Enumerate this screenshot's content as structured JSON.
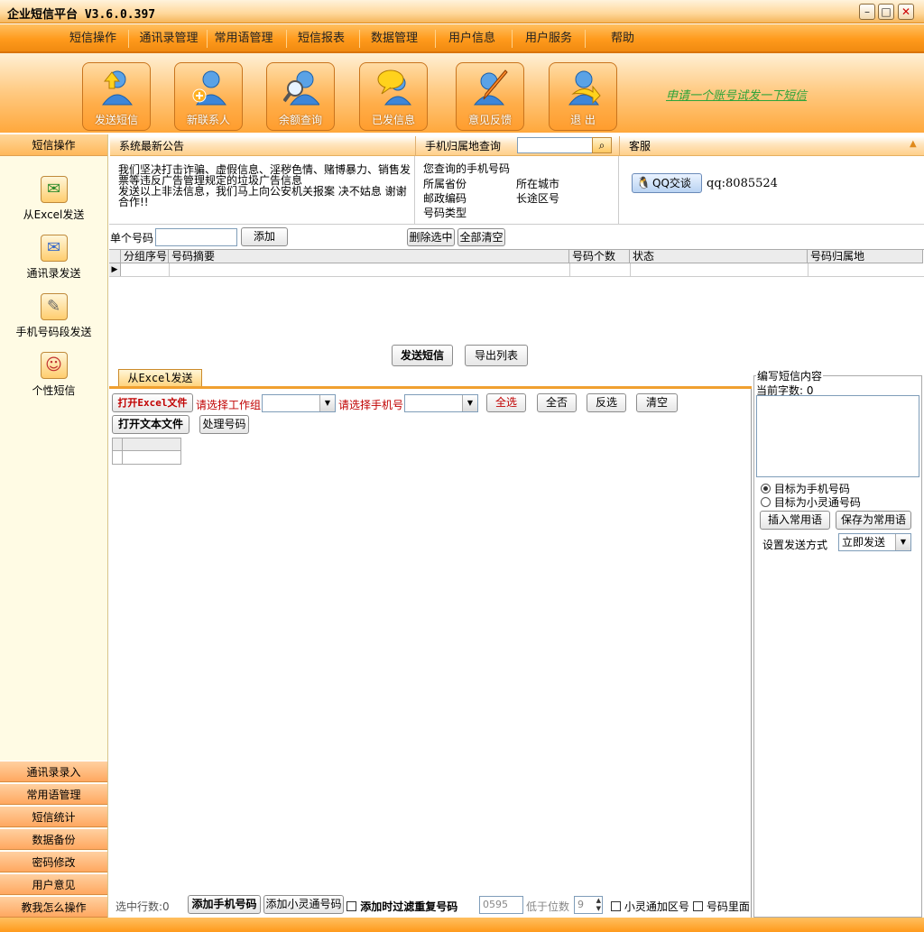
{
  "app": {
    "title": "企业短信平台 V3.6.0.397"
  },
  "window_controls": {
    "minimize": "–",
    "maximize": "□",
    "close": "✕"
  },
  "menu": [
    "短信操作",
    "通讯录管理",
    "常用语管理",
    "短信报表",
    "数据管理",
    "用户信息",
    "用户服务",
    "帮助"
  ],
  "toolbar": [
    {
      "label": "发送短信",
      "icon": "send-sms-icon"
    },
    {
      "label": "新联系人",
      "icon": "new-contact-icon"
    },
    {
      "label": "余额查询",
      "icon": "balance-query-icon"
    },
    {
      "label": "已发信息",
      "icon": "sent-messages-icon"
    },
    {
      "label": "意见反馈",
      "icon": "feedback-icon"
    },
    {
      "label": "退  出",
      "icon": "exit-icon"
    }
  ],
  "trial_link": "申请一个账号试发一下短信",
  "sidebar": {
    "header": "短信操作",
    "items": [
      {
        "label": "从Excel发送",
        "icon": "excel-send-icon"
      },
      {
        "label": "通讯录发送",
        "icon": "addressbook-send-icon"
      },
      {
        "label": "手机号码段发送",
        "icon": "number-range-send-icon"
      },
      {
        "label": "个性短信",
        "icon": "personal-sms-icon"
      }
    ],
    "bottom": [
      "通讯录录入",
      "常用语管理",
      "短信统计",
      "数据备份",
      "密码修改",
      "用户意见",
      "教我怎么操作"
    ]
  },
  "notice": {
    "header": "系统最新公告",
    "lines": [
      "我们坚决打击诈骗、虚假信息、淫秽色情、赌博暴力、销售发",
      "票等违反广告管理规定的垃圾广告信息",
      "发送以上非法信息，我们马上向公安机关报案 决不姑息 谢谢",
      "合作!!"
    ]
  },
  "lookup": {
    "header": "手机归属地查询",
    "query_label": "您查询的手机号码",
    "province": "所属省份",
    "city": "所在城市",
    "postcode": "邮政编码",
    "areacode": "长途区号",
    "type": "号码类型"
  },
  "service": {
    "header": "客服",
    "qq_button": "QQ交谈",
    "qq": "qq:8085524"
  },
  "single": {
    "label": "单个号码",
    "add": "添加",
    "delete_selected": "删除选中",
    "clear_all": "全部清空"
  },
  "grid": {
    "columns": [
      "分组序号",
      "号码摘要",
      "号码个数",
      "状态",
      "号码归属地"
    ]
  },
  "actions": {
    "send": "发送短信",
    "export": "导出列表"
  },
  "excel_tab": {
    "tab": "从Excel发送",
    "open_excel": "打开Excel文件",
    "select_sheet": "请选择工作组",
    "select_phone": "请选择手机号",
    "select_all": "全选",
    "select_none": "全否",
    "invert": "反选",
    "clear": "清空",
    "open_text": "打开文本文件",
    "process": "处理号码"
  },
  "compose": {
    "title": "编写短信内容",
    "count_label": "当前字数:",
    "count": "0",
    "target_mobile": "目标为手机号码",
    "target_phs": "目标为小灵通号码",
    "insert_phrase": "插入常用语",
    "save_phrase": "保存为常用语",
    "send_mode_label": "设置发送方式",
    "send_mode": "立即发送"
  },
  "footer": {
    "selected_rows": "选中行数:0",
    "add_mobile": "添加手机号码",
    "add_phs": "添加小灵通号码",
    "filter_dup": "添加时过滤重复号码",
    "prefix": "0595",
    "digits_label": "低于位数",
    "digits": "9",
    "phs_area": "小灵通加区号",
    "in_number": "号码里面"
  }
}
